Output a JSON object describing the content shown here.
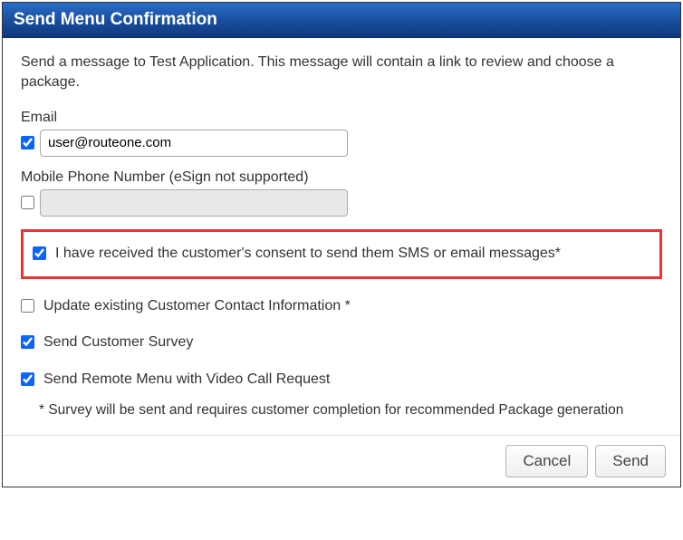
{
  "dialog": {
    "title": "Send Menu Confirmation",
    "intro": "Send a message to Test Application. This message will contain a link to review and choose a package."
  },
  "email": {
    "label": "Email",
    "value": "user@routeone.com",
    "checked": true
  },
  "mobile": {
    "label": "Mobile Phone Number (eSign not supported)",
    "value": "",
    "checked": false
  },
  "consent": {
    "label": "I have received the customer's consent to send them SMS or email messages*",
    "checked": true
  },
  "updateContact": {
    "label": "Update existing Customer Contact Information *",
    "checked": false
  },
  "survey": {
    "label": "Send Customer Survey",
    "checked": true
  },
  "remoteMenu": {
    "label": "Send Remote Menu with Video Call Request",
    "checked": true
  },
  "note": "* Survey will be sent and requires customer completion for recommended Package generation",
  "buttons": {
    "cancel": "Cancel",
    "send": "Send"
  }
}
